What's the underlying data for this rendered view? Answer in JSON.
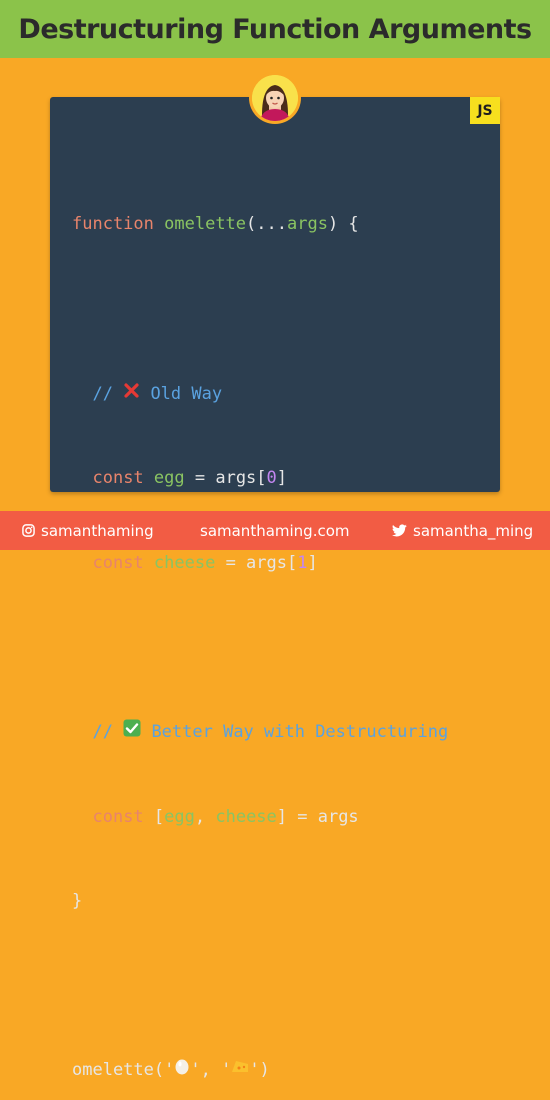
{
  "header": {
    "title": "Destructuring Function Arguments"
  },
  "badge": {
    "label": "JS"
  },
  "avatar": {
    "icon": "woman-avatar-icon"
  },
  "code": {
    "l1": {
      "kw": "function",
      "fn": "omelette",
      "p1": "(...",
      "arg": "args",
      "p2": ") {"
    },
    "l2": {
      "comment_prefix": "// ",
      "icon": "cross-mark-icon",
      "comment_text": " Old Way"
    },
    "l3": {
      "kw": "const",
      "var": "egg",
      "p1": " = args[",
      "num": "0",
      "p2": "]"
    },
    "l4": {
      "kw": "const",
      "var": "cheese",
      "p1": " = args[",
      "num": "1",
      "p2": "]"
    },
    "l5": {
      "comment_prefix": "// ",
      "icon": "check-mark-icon",
      "comment_text": " Better Way with Destructuring"
    },
    "l6": {
      "kw": "const",
      "p1": " [",
      "v1": "egg",
      "sep": ", ",
      "v2": "cheese",
      "p2": "] = args"
    },
    "l7": {
      "close": "}"
    },
    "l8": {
      "p1": "omelette('",
      "icon1": "egg-icon",
      "p2": "', '",
      "icon2": "cheese-icon",
      "p3": "')"
    }
  },
  "footer": {
    "instagram": "samanthaming",
    "website": "samanthaming.com",
    "twitter": "samantha_ming"
  },
  "colors": {
    "background": "#f9a825",
    "title_bar": "#8bc34a",
    "card": "#2c3e50",
    "footer": "#f25c44",
    "keyword": "#e8846b",
    "name": "#8ac462",
    "comment": "#5aa2e0",
    "number": "#c386f1"
  }
}
